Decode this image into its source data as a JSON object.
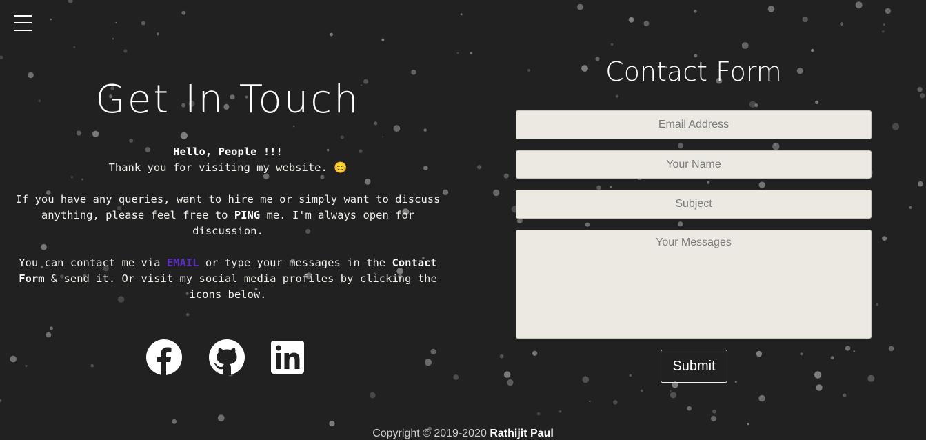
{
  "nav": {
    "menu_icon": "hamburger-menu-icon"
  },
  "left": {
    "heading": "Get In Touch",
    "greeting": "Hello, People !!!",
    "thanks": "Thank you for visiting my website. 😊",
    "para1_before": "If you have any queries, want to hire me or simply want to discuss anything, please feel free to ",
    "para1_bold": "PING",
    "para1_after": " me. I'm always open for discussion.",
    "para2_before": "You can contact me via ",
    "para2_link": "EMAIL",
    "para2_mid": " or type your messages in the ",
    "para2_bold": "Contact Form",
    "para2_after": " & send it. Or visit my social media profiles by clicking the icons below."
  },
  "social": [
    {
      "name": "facebook",
      "icon": "facebook-icon"
    },
    {
      "name": "github",
      "icon": "github-icon"
    },
    {
      "name": "linkedin",
      "icon": "linkedin-icon"
    }
  ],
  "form": {
    "title": "Contact Form",
    "email_placeholder": "Email Address",
    "name_placeholder": "Your Name",
    "subject_placeholder": "Subject",
    "message_placeholder": "Your Messages",
    "submit_label": "Submit"
  },
  "footer": {
    "text": "Copyright © 2019-2020 ",
    "author": "Rathijit Paul"
  },
  "colors": {
    "background": "#222121",
    "link": "#5b2fbf",
    "field_bg": "#ece9e2",
    "particle": "#8a8a8a"
  }
}
